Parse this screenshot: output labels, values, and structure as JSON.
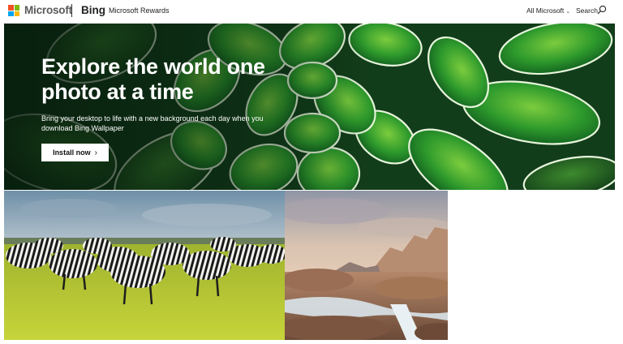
{
  "header": {
    "brand": "Microsoft",
    "product": "Bing",
    "rewards_link": "Microsoft Rewards",
    "all_microsoft": "All Microsoft",
    "search_label": "Search",
    "logo_colors": [
      "#f25022",
      "#7fba00",
      "#00a4ef",
      "#ffb900"
    ]
  },
  "hero": {
    "title": "Explore the world one photo at a time",
    "subtitle": "Bring your desktop to life with a new background each day when you download Bing Wallpaper",
    "cta_label": "Install now",
    "cta_icon": "chevron-right-icon"
  },
  "gallery": [
    {
      "image": "zebra-herd-photo"
    },
    {
      "image": "rocky-river-canyon-photo"
    }
  ]
}
